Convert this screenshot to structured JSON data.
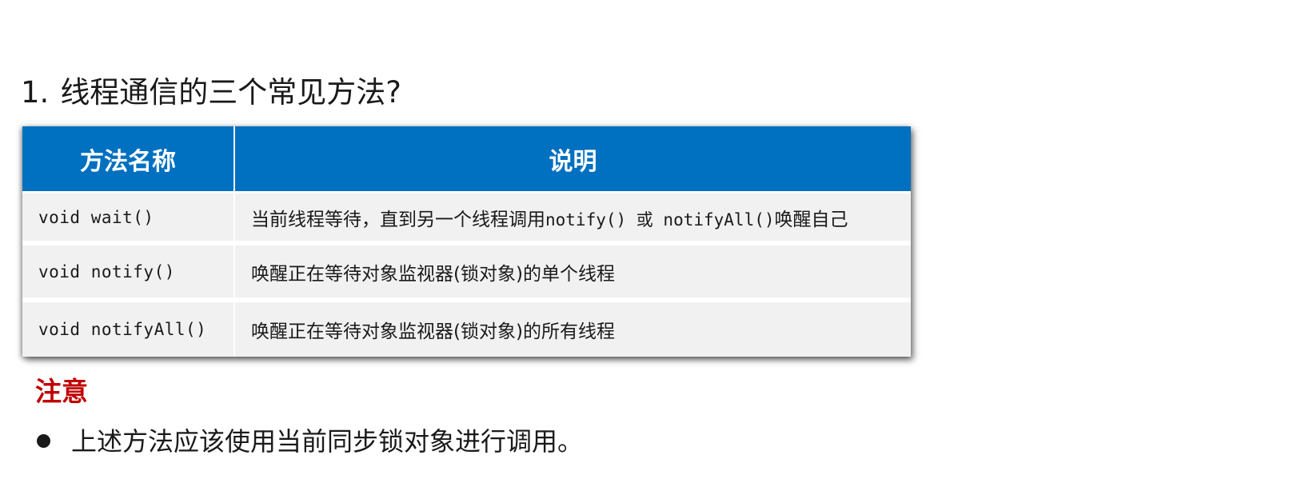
{
  "heading": {
    "number": "1.",
    "text": "线程通信的三个常见方法?"
  },
  "table": {
    "headers": [
      "方法名称",
      "说明"
    ],
    "rows": [
      {
        "method": "void wait()",
        "desc_parts": [
          "当前线程等待，直到另一个线程调用",
          "notify() 或 notifyAll()",
          "唤醒自己"
        ]
      },
      {
        "method": "void notify()",
        "desc_parts": [
          "唤醒正在等待对象监视器(锁对象)的单个线程",
          "",
          ""
        ]
      },
      {
        "method": "void notifyAll()",
        "desc_parts": [
          "唤醒正在等待对象监视器(锁对象)的所有线程",
          "",
          ""
        ]
      }
    ],
    "header_color": "#0070c0",
    "row_color": "#f1f1f1"
  },
  "note": {
    "title": "注意",
    "title_color": "#c00000",
    "bullets": [
      "上述方法应该使用当前同步锁对象进行调用。"
    ]
  }
}
